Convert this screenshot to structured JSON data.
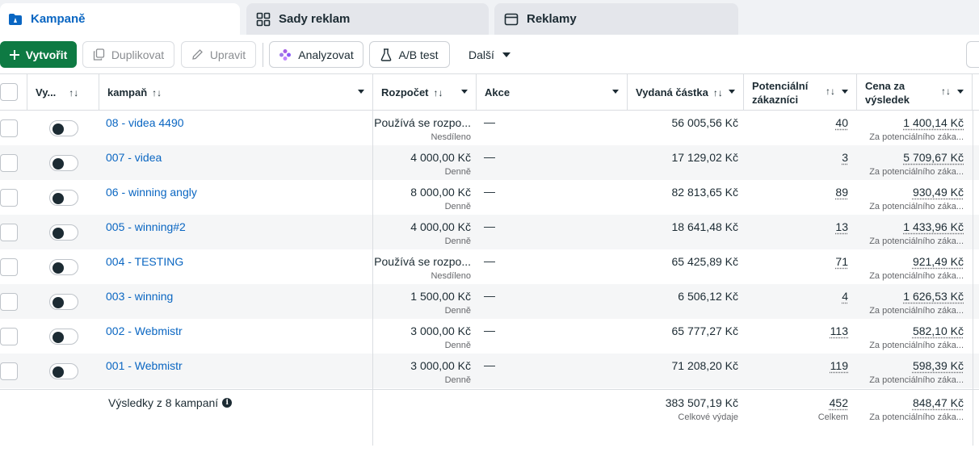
{
  "tabs": [
    {
      "label": "Kampaně",
      "icon": "campaign-folder-icon",
      "active": true
    },
    {
      "label": "Sady reklam",
      "icon": "grid-icon",
      "active": false
    },
    {
      "label": "Reklamy",
      "icon": "ad-window-icon",
      "active": false
    }
  ],
  "toolbar": {
    "create": "Vytvořit",
    "duplicate": "Duplikovat",
    "edit": "Upravit",
    "analyze": "Analyzovat",
    "ab_test": "A/B test",
    "more": "Další"
  },
  "columns": {
    "onoff": "Vy...",
    "campaign": "kampaň",
    "budget": "Rozpočet",
    "actions": "Akce",
    "spent": "Vydaná částka",
    "leads_line1": "Potenciální",
    "leads_line2": "zákazníci",
    "cpr_line1": "Cena za",
    "cpr_line2": "výsledek"
  },
  "rows": [
    {
      "name": "08 - videa 4490",
      "budget": "Používá se rozpo...",
      "budget_sub": "Nesdíleno",
      "action": "—",
      "spent": "56 005,56 Kč",
      "leads": "40",
      "cpr": "1 400,14 Kč",
      "cpr_sub": "Za potenciálního záka..."
    },
    {
      "name": "007 - videa",
      "budget": "4 000,00 Kč",
      "budget_sub": "Denně",
      "action": "—",
      "spent": "17 129,02 Kč",
      "leads": "3",
      "cpr": "5 709,67 Kč",
      "cpr_sub": "Za potenciálního záka..."
    },
    {
      "name": "06 - winning angly",
      "budget": "8 000,00 Kč",
      "budget_sub": "Denně",
      "action": "—",
      "spent": "82 813,65 Kč",
      "leads": "89",
      "cpr": "930,49 Kč",
      "cpr_sub": "Za potenciálního záka..."
    },
    {
      "name": "005 - winning#2",
      "budget": "4 000,00 Kč",
      "budget_sub": "Denně",
      "action": "—",
      "spent": "18 641,48 Kč",
      "leads": "13",
      "cpr": "1 433,96 Kč",
      "cpr_sub": "Za potenciálního záka..."
    },
    {
      "name": "004 - TESTING",
      "budget": "Používá se rozpo...",
      "budget_sub": "Nesdíleno",
      "action": "—",
      "spent": "65 425,89 Kč",
      "leads": "71",
      "cpr": "921,49 Kč",
      "cpr_sub": "Za potenciálního záka..."
    },
    {
      "name": "003 - winning",
      "budget": "1 500,00 Kč",
      "budget_sub": "Denně",
      "action": "—",
      "spent": "6 506,12 Kč",
      "leads": "4",
      "cpr": "1 626,53 Kč",
      "cpr_sub": "Za potenciálního záka..."
    },
    {
      "name": "002 - Webmistr",
      "budget": "3 000,00 Kč",
      "budget_sub": "Denně",
      "action": "—",
      "spent": "65 777,27 Kč",
      "leads": "113",
      "cpr": "582,10 Kč",
      "cpr_sub": "Za potenciálního záka..."
    },
    {
      "name": "001 - Webmistr",
      "budget": "3 000,00 Kč",
      "budget_sub": "Denně",
      "action": "—",
      "spent": "71 208,20 Kč",
      "leads": "119",
      "cpr": "598,39 Kč",
      "cpr_sub": "Za potenciálního záka..."
    }
  ],
  "summary": {
    "label": "Výsledky z 8 kampaní",
    "spent": "383 507,19 Kč",
    "spent_sub": "Celkové výdaje",
    "leads": "452",
    "leads_sub": "Celkem",
    "cpr": "848,47 Kč",
    "cpr_sub": "Za potenciálního záka..."
  },
  "colors": {
    "accent": "#0a66c2",
    "create_button": "#0e7a43"
  }
}
